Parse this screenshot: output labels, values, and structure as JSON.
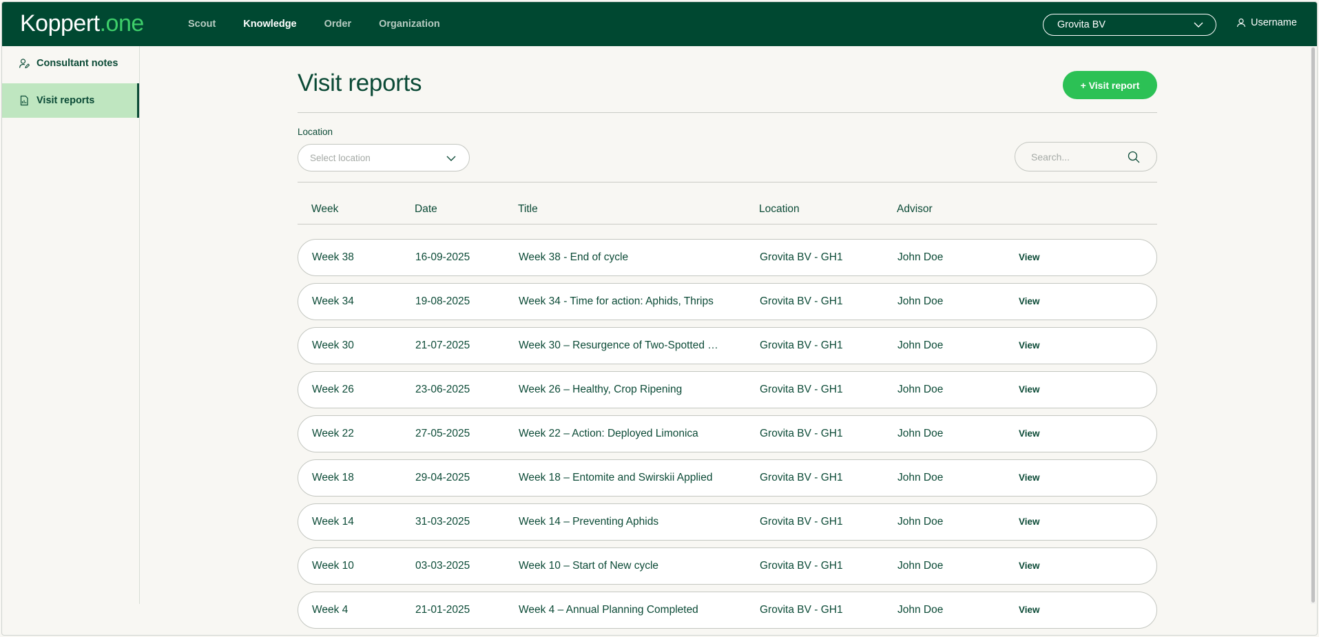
{
  "brand": {
    "part1": "Koppert",
    "part2": ".one"
  },
  "nav": [
    {
      "label": "Scout",
      "active": false
    },
    {
      "label": "Knowledge",
      "active": true
    },
    {
      "label": "Order",
      "active": false
    },
    {
      "label": "Organization",
      "active": false
    }
  ],
  "org_selector": {
    "value": "Grovita BV",
    "icon": "chevron-down-icon"
  },
  "user": {
    "name": "Username",
    "icon": "user-icon"
  },
  "sidebar": {
    "items": [
      {
        "label": "Consultant notes",
        "icon": "person-note-icon",
        "active": false
      },
      {
        "label": "Visit reports",
        "icon": "document-icon",
        "active": true
      }
    ]
  },
  "page": {
    "title": "Visit reports",
    "add_button_label": "+ Visit report"
  },
  "filters": {
    "location_label": "Location",
    "location_placeholder": "Select location",
    "search_placeholder": "Search..."
  },
  "table": {
    "headers": [
      "Week",
      "Date",
      "Title",
      "Location",
      "Advisor"
    ],
    "view_label": "View",
    "rows": [
      {
        "week": "Week 38",
        "date": "16-09-2025",
        "title": "Week 38 - End of cycle",
        "location": "Grovita BV - GH1",
        "advisor": "John Doe"
      },
      {
        "week": "Week 34",
        "date": "19-08-2025",
        "title": "Week 34 - Time for action: Aphids, Thrips",
        "location": "Grovita BV - GH1",
        "advisor": "John Doe"
      },
      {
        "week": "Week 30",
        "date": "21-07-2025",
        "title": "Week 30 – Resurgence of Two-Spotted …",
        "location": "Grovita BV - GH1",
        "advisor": "John Doe"
      },
      {
        "week": "Week 26",
        "date": "23-06-2025",
        "title": "Week 26 – Healthy, Crop Ripening",
        "location": "Grovita BV - GH1",
        "advisor": "John Doe"
      },
      {
        "week": "Week 22",
        "date": "27-05-2025",
        "title": "Week 22 – Action: Deployed Limonica",
        "location": "Grovita BV - GH1",
        "advisor": "John Doe"
      },
      {
        "week": "Week 18",
        "date": "29-04-2025",
        "title": "Week 18 – Entomite and Swirskii Applied",
        "location": "Grovita BV - GH1",
        "advisor": "John Doe"
      },
      {
        "week": "Week 14",
        "date": "31-03-2025",
        "title": "Week 14 – Preventing Aphids",
        "location": "Grovita BV - GH1",
        "advisor": "John Doe"
      },
      {
        "week": "Week 10",
        "date": "03-03-2025",
        "title": "Week 10 – Start of New cycle",
        "location": "Grovita BV - GH1",
        "advisor": "John Doe"
      },
      {
        "week": "Week 4",
        "date": "21-01-2025",
        "title": "Week 4 – Annual Planning Completed",
        "location": "Grovita BV - GH1",
        "advisor": "John Doe"
      }
    ]
  },
  "colors": {
    "header_bg": "#004831",
    "accent_green": "#2cc155",
    "sidebar_active_bg": "#bfe6c0",
    "text_primary": "#0b4a36",
    "page_bg": "#f8f7f3"
  }
}
